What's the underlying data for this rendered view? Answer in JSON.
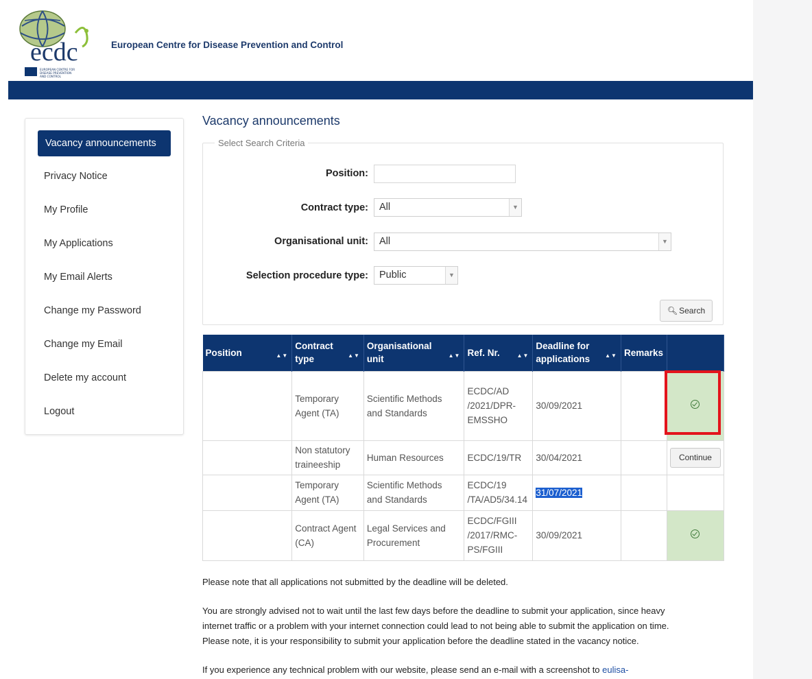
{
  "header": {
    "org_name": "European Centre for Disease Prevention and Control",
    "logo_text": "ecdc",
    "logo_subtext_lines": [
      "EUROPEAN CENTRE FOR",
      "DISEASE PREVENTION",
      "AND CONTROL"
    ],
    "brand_color": "#0d3570"
  },
  "sidebar": {
    "items": [
      {
        "label": "Vacancy announcements",
        "active": true
      },
      {
        "label": "Privacy Notice"
      },
      {
        "label": "My Profile"
      },
      {
        "label": "My Applications"
      },
      {
        "label": "My Email Alerts"
      },
      {
        "label": "Change my Password"
      },
      {
        "label": "Change my Email"
      },
      {
        "label": "Delete my account"
      },
      {
        "label": "Logout"
      }
    ]
  },
  "main": {
    "title": "Vacancy announcements",
    "criteria": {
      "legend": "Select Search Criteria",
      "position_label": "Position:",
      "position_value": "",
      "contract_type_label": "Contract type:",
      "contract_type_value": "All",
      "org_unit_label": "Organisational unit:",
      "org_unit_value": "All",
      "procedure_label": "Selection procedure type:",
      "procedure_value": "Public",
      "search_label": "Search"
    },
    "table": {
      "headers": {
        "position": "Position",
        "contract_1": "Contract",
        "contract_2": "type",
        "org_1": "Organisational",
        "org_2": "unit",
        "ref": "Ref. Nr.",
        "deadline_1": "Deadline for",
        "deadline_2": "applications",
        "remarks": "Remarks"
      },
      "rows": [
        {
          "position": "",
          "contract": [
            "Temporary",
            "Agent (TA)"
          ],
          "org": [
            "Scientific Methods",
            "and Standards"
          ],
          "ref": [
            "ECDC/AD",
            "/2021/DPR-",
            "EMSSHO"
          ],
          "deadline": "30/09/2021",
          "remarks": "",
          "action": "check"
        },
        {
          "position": "",
          "contract": [
            "Non statutory",
            "traineeship"
          ],
          "org": [
            "Human Resources"
          ],
          "ref": [
            "ECDC/19/TR"
          ],
          "deadline": "30/04/2021",
          "remarks": "",
          "action": "Continue"
        },
        {
          "position": "",
          "contract": [
            "Temporary",
            "Agent (TA)"
          ],
          "org": [
            "Scientific Methods",
            "and Standards"
          ],
          "ref": [
            "ECDC/19",
            "/TA/AD5/34.14"
          ],
          "deadline": "31/07/2021",
          "remarks": "",
          "action": ""
        },
        {
          "position": "",
          "contract": [
            "Contract Agent",
            "(CA)"
          ],
          "org": [
            "Legal Services and",
            "Procurement"
          ],
          "ref": [
            "ECDC/FGIII",
            "/2017/RMC-",
            "PS/FGIII"
          ],
          "deadline": "30/09/2021",
          "remarks": "",
          "action": "check"
        }
      ]
    },
    "notes": {
      "note1": "Please note that all applications not submitted by the deadline will be deleted.",
      "note2_l1": "You are strongly advised not to wait until the last few days before the deadline to submit your application, since heavy",
      "note2_l2": "internet traffic or a problem with your internet connection could lead to not being able to submit the application on time.",
      "note2_l3": "Please note, it is your responsibility to submit your application before the deadline stated in the vacancy notice.",
      "note3": "If you experience any technical problem with our website, please send an e-mail with a screenshot to ",
      "note3_link": "eulisa-"
    }
  }
}
